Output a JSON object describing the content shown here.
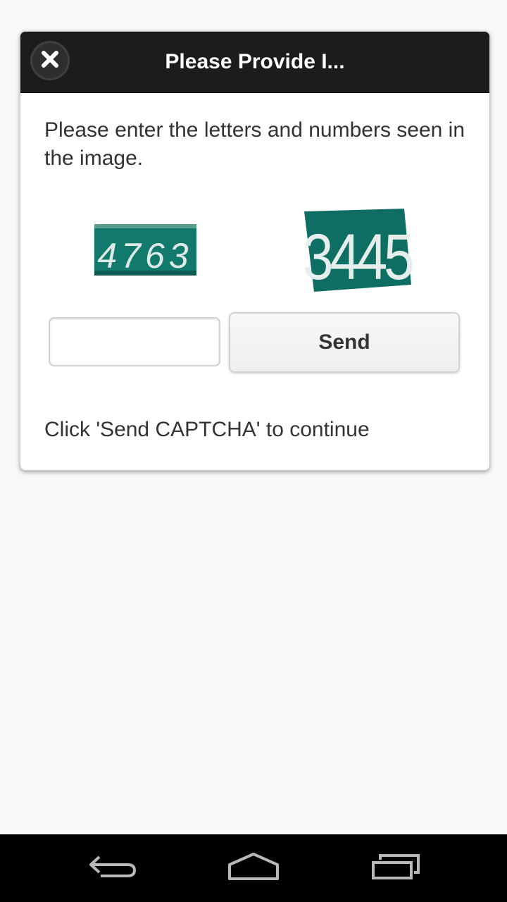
{
  "dialog": {
    "title": "Please Provide I...",
    "close_icon": "close-icon",
    "instruction": "Please enter the letters and numbers seen in the image.",
    "captcha_images": [
      {
        "text": "4763",
        "bg_color": "#127a6c"
      },
      {
        "text": "3445",
        "bg_color": "#0f6e64"
      }
    ],
    "input": {
      "value": "",
      "placeholder": ""
    },
    "send_label": "Send",
    "status": "Click 'Send CAPTCHA' to continue"
  },
  "navbar": {
    "back_icon": "back-icon",
    "home_icon": "home-icon",
    "recent_apps_icon": "recent-apps-icon"
  },
  "colors": {
    "header_bg": "#1c1c1c",
    "page_bg": "#f8f8f8",
    "navbar_bg": "#000000"
  }
}
